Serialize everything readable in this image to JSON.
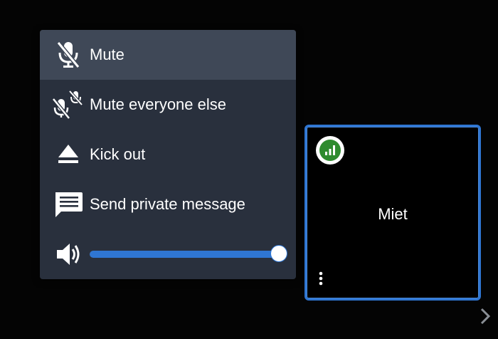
{
  "menu": {
    "items": [
      {
        "label": "Mute",
        "icon": "mic-off-icon"
      },
      {
        "label": "Mute everyone else",
        "icon": "mute-others-icon"
      },
      {
        "label": "Kick out",
        "icon": "eject-icon"
      },
      {
        "label": "Send private message",
        "icon": "message-icon"
      }
    ],
    "volume": {
      "icon": "volume-icon",
      "level_percent": 100
    }
  },
  "participant_tile": {
    "name": "Miet",
    "connection_indicator": "signal-bars-icon",
    "options_icon": "kebab-menu-icon"
  },
  "navigation": {
    "next_icon": "chevron-right-icon"
  },
  "colors": {
    "menu_background": "#29303d",
    "menu_highlight": "#3f4857",
    "accent": "#2f76d3",
    "signal_good": "#2e8b2e"
  }
}
